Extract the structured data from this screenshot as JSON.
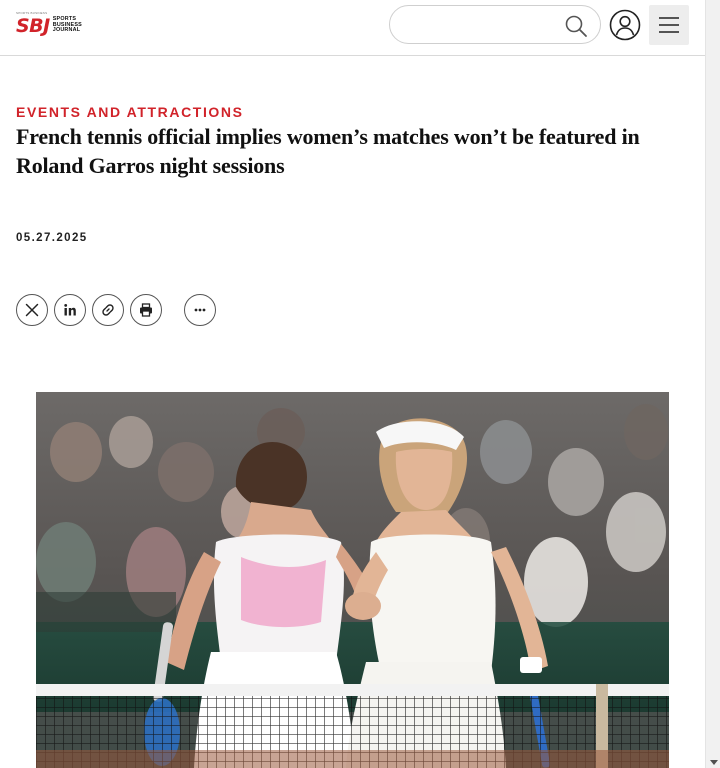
{
  "header": {
    "logo": {
      "mark": "SBJ",
      "line1": "SPORTS",
      "line2": "BUSINESS",
      "line3": "JOURNAL",
      "tag": "SPORTS BUSINESS"
    },
    "search": {
      "value": "",
      "placeholder": ""
    },
    "icons": {
      "search": "search-icon",
      "user": "user-icon",
      "menu": "menu-icon"
    }
  },
  "article": {
    "category": "EVENTS AND ATTRACTIONS",
    "headline": "French tennis official implies women’s matches won’t be featured in Roland Garros night sessions",
    "date": "05.27.2025",
    "share": [
      "x-icon",
      "linkedin-icon",
      "link-icon",
      "print-icon",
      "more-icon"
    ]
  },
  "colors": {
    "accent": "#d1232a",
    "text": "#111111",
    "court": "#9b5a3c",
    "net_tape": "#f2f2f2"
  }
}
